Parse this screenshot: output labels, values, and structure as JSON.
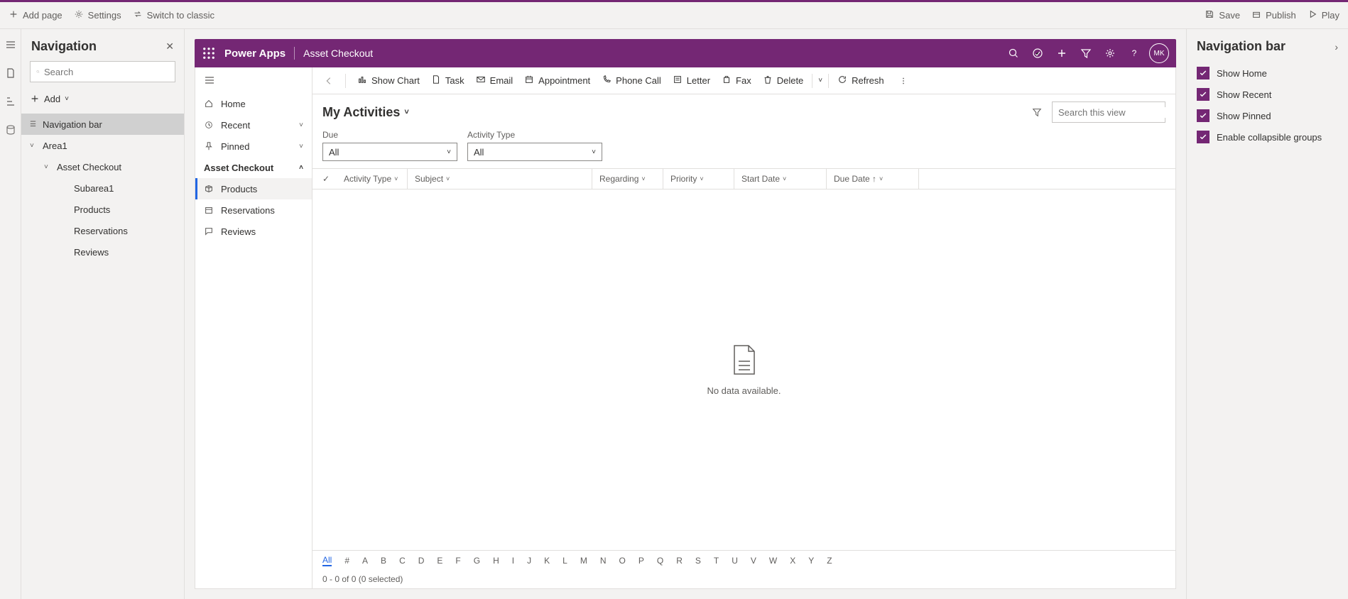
{
  "topbar": {
    "left": [
      {
        "icon": "plus",
        "label": "Add page"
      },
      {
        "icon": "gear",
        "label": "Settings"
      },
      {
        "icon": "switch",
        "label": "Switch to classic"
      }
    ],
    "right": [
      {
        "icon": "save",
        "label": "Save"
      },
      {
        "icon": "publish",
        "label": "Publish"
      },
      {
        "icon": "play",
        "label": "Play"
      }
    ]
  },
  "leftpanel": {
    "title": "Navigation",
    "search_placeholder": "Search",
    "add_label": "Add",
    "tree": [
      {
        "depth": 1,
        "label": "Navigation bar",
        "selected": true,
        "chevron": "☰"
      },
      {
        "depth": 1,
        "label": "Area1",
        "chevron": "˅"
      },
      {
        "depth": 2,
        "label": "Asset Checkout",
        "chevron": "˅"
      },
      {
        "depth": 3,
        "label": "Subarea1"
      },
      {
        "depth": 3,
        "label": "Products"
      },
      {
        "depth": 3,
        "label": "Reservations"
      },
      {
        "depth": 3,
        "label": "Reviews"
      }
    ]
  },
  "purple": {
    "brand": "Power Apps",
    "app": "Asset Checkout",
    "avatar": "MK"
  },
  "sitemap": {
    "items": [
      {
        "type": "row",
        "icon": "home",
        "label": "Home"
      },
      {
        "type": "row",
        "icon": "recent",
        "label": "Recent",
        "expand": true
      },
      {
        "type": "row",
        "icon": "pin",
        "label": "Pinned",
        "expand": true
      },
      {
        "type": "group",
        "label": "Asset Checkout"
      },
      {
        "type": "row",
        "icon": "product",
        "label": "Products",
        "active": true
      },
      {
        "type": "row",
        "icon": "reservation",
        "label": "Reservations"
      },
      {
        "type": "row",
        "icon": "review",
        "label": "Reviews"
      }
    ]
  },
  "cmdbar": [
    {
      "icon": "chart",
      "label": "Show Chart"
    },
    {
      "icon": "task",
      "label": "Task"
    },
    {
      "icon": "email",
      "label": "Email"
    },
    {
      "icon": "appointment",
      "label": "Appointment"
    },
    {
      "icon": "phone",
      "label": "Phone Call"
    },
    {
      "icon": "letter",
      "label": "Letter"
    },
    {
      "icon": "fax",
      "label": "Fax"
    },
    {
      "icon": "delete",
      "label": "Delete"
    },
    {
      "icon": "refresh",
      "label": "Refresh"
    }
  ],
  "view": {
    "title": "My Activities",
    "search_placeholder": "Search this view"
  },
  "filters": {
    "due_label": "Due",
    "due_value": "All",
    "type_label": "Activity Type",
    "type_value": "All"
  },
  "grid_columns": [
    "Activity Type",
    "Subject",
    "Regarding",
    "Priority",
    "Start Date",
    "Due Date ↑"
  ],
  "empty_text": "No data available.",
  "alphabet": [
    "All",
    "#",
    "A",
    "B",
    "C",
    "D",
    "E",
    "F",
    "G",
    "H",
    "I",
    "J",
    "K",
    "L",
    "M",
    "N",
    "O",
    "P",
    "Q",
    "R",
    "S",
    "T",
    "U",
    "V",
    "W",
    "X",
    "Y",
    "Z"
  ],
  "status_text": "0 - 0 of 0 (0 selected)",
  "rightpanel": {
    "title": "Navigation bar",
    "checks": [
      "Show Home",
      "Show Recent",
      "Show Pinned",
      "Enable collapsible groups"
    ]
  }
}
